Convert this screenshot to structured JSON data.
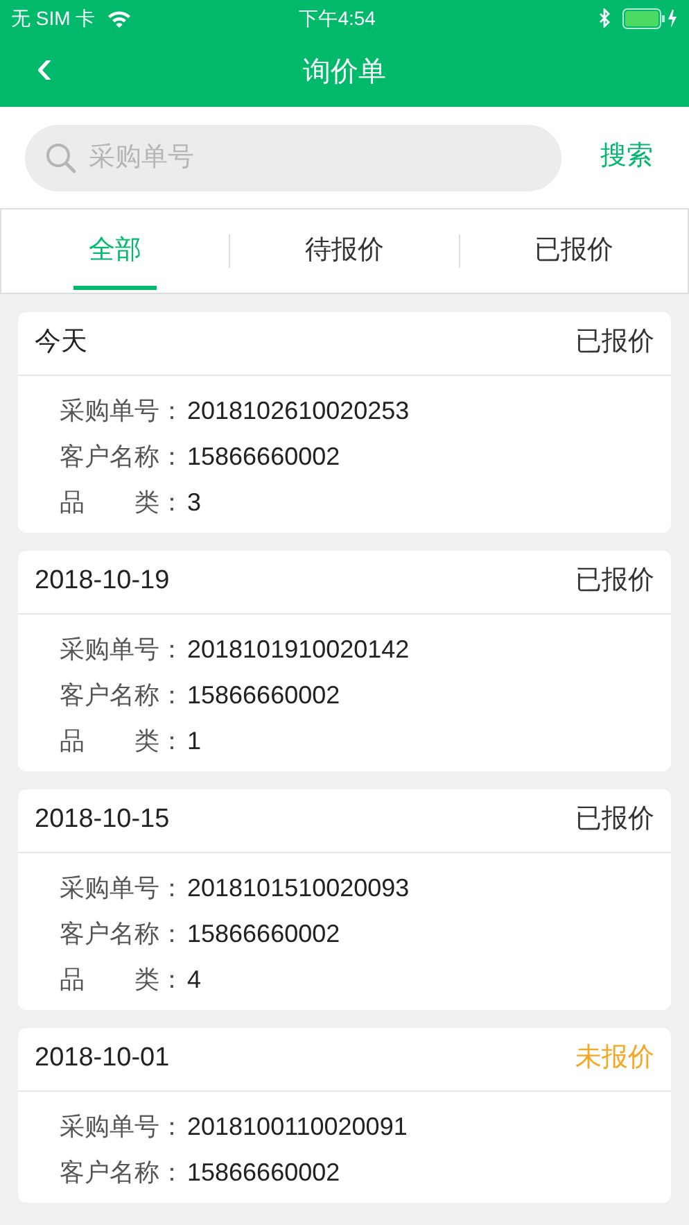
{
  "status_bar": {
    "carrier": "无 SIM 卡",
    "time": "下午4:54"
  },
  "nav": {
    "back": "‹",
    "title": "询价单"
  },
  "search": {
    "placeholder": "采购单号",
    "button": "搜索"
  },
  "tabs": [
    {
      "label": "全部",
      "selected": true
    },
    {
      "label": "待报价",
      "selected": false
    },
    {
      "label": "已报价",
      "selected": false
    }
  ],
  "orders": [
    {
      "date": "今天",
      "status": "已报价",
      "quoted": true,
      "fields": [
        {
          "label": "采购单号：",
          "value": "2018102610020253"
        },
        {
          "label": "客户名称：",
          "value": "15866660002"
        },
        {
          "label": "品　　类：",
          "value": "3"
        }
      ]
    },
    {
      "date": "2018-10-19",
      "status": "已报价",
      "quoted": true,
      "fields": [
        {
          "label": "采购单号：",
          "value": "2018101910020142"
        },
        {
          "label": "客户名称：",
          "value": "15866660002"
        },
        {
          "label": "品　　类：",
          "value": "1"
        }
      ]
    },
    {
      "date": "2018-10-15",
      "status": "已报价",
      "quoted": true,
      "fields": [
        {
          "label": "采购单号：",
          "value": "2018101510020093"
        },
        {
          "label": "客户名称：",
          "value": "15866660002"
        },
        {
          "label": "品　　类：",
          "value": "4"
        }
      ]
    },
    {
      "date": "2018-10-01",
      "status": "未报价",
      "quoted": false,
      "fields": [
        {
          "label": "采购单号：",
          "value": "2018100110020091"
        },
        {
          "label": "客户名称：",
          "value": "15866660002"
        }
      ]
    }
  ]
}
